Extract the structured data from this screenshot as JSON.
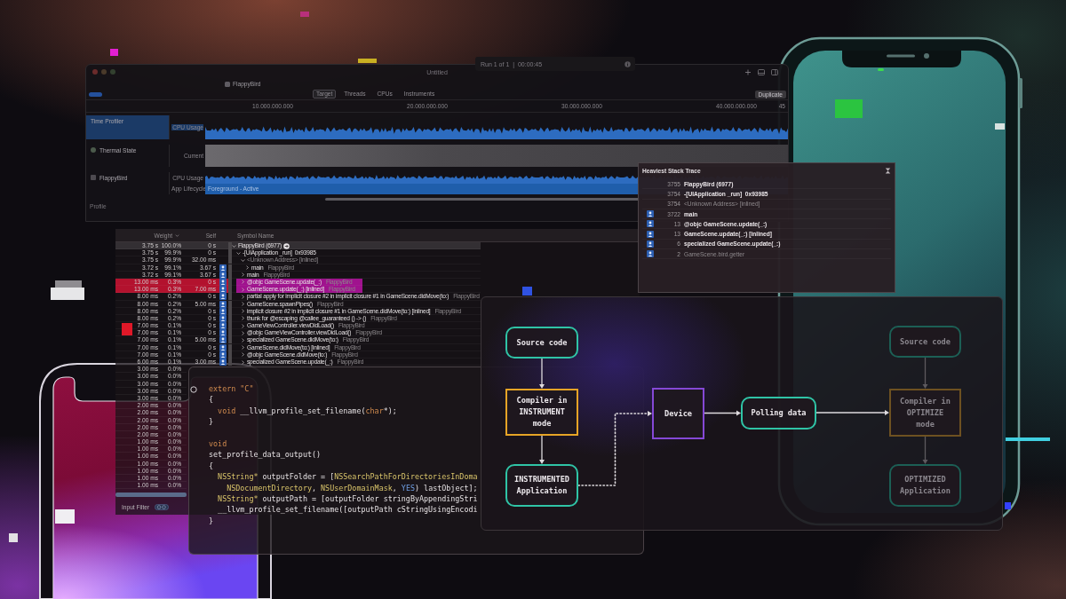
{
  "instruments_window": {
    "title": "Untitled",
    "run_status": "Run 1 of 1  |  00:00:45",
    "target_app": "FlappyBird",
    "tabs": [
      {
        "label": "Target",
        "selected": true
      },
      {
        "label": "Threads",
        "selected": false
      },
      {
        "label": "CPUs",
        "selected": false
      },
      {
        "label": "Instruments",
        "selected": false
      }
    ],
    "duplicate_button": "Duplicate",
    "ruler_labels": [
      "10.000.000.000",
      "20.000.000.000",
      "30.000.000.000",
      "40.000.000.000",
      "45"
    ],
    "tracks": [
      {
        "kind": "profiler",
        "name": "Time Profiler",
        "selected": true,
        "lanes": [
          {
            "kind": "waveform",
            "label": "CPU Usage"
          }
        ]
      },
      {
        "kind": "thermal",
        "name": "Thermal State",
        "selected": false,
        "lanes": [
          {
            "kind": "state_band",
            "label": "Current"
          }
        ]
      },
      {
        "kind": "process",
        "name": "FlappyBird",
        "selected": false,
        "lanes": [
          {
            "kind": "waveform",
            "label": "CPU Usage"
          },
          {
            "kind": "lifecycle_band",
            "label": "App Lifecycle",
            "value": "Foreground - Active"
          }
        ]
      }
    ],
    "section_label": "Profile"
  },
  "call_tree": {
    "columns": [
      "Weight",
      "Self",
      "Symbol Name"
    ],
    "rows": [
      {
        "weight": "3.75 s",
        "percent": "100.0%",
        "self": "0 s",
        "symbol": "FlappyBird (6977)",
        "selected": true,
        "expanded": true,
        "highlighted": false,
        "user_code": false,
        "dimmed": false,
        "children": [
          {
            "weight": "3.75 s",
            "percent": "99.9%",
            "self": "0 s",
            "symbol": "-[UIApplication _run]  0x93985",
            "selected": false,
            "expanded": true,
            "highlighted": false,
            "user_code": false,
            "dimmed": false,
            "children": [
              {
                "weight": "3.75 s",
                "percent": "99.9%",
                "self": "32.00 ms",
                "symbol": "<Unknown Address> [inlined]",
                "selected": false,
                "expanded": true,
                "highlighted": false,
                "user_code": false,
                "dimmed": true,
                "children": [
                  {
                    "weight": "3.72 s",
                    "percent": "99.1%",
                    "self": "3.67 s",
                    "symbol": "main",
                    "library": "FlappyBird",
                    "selected": false,
                    "expanded": false,
                    "highlighted": false,
                    "user_code": true,
                    "dimmed": false
                  }
                ]
              },
              {
                "weight": "3.72 s",
                "percent": "99.1%",
                "self": "3.67 s",
                "symbol": "main",
                "library": "FlappyBird",
                "selected": false,
                "expanded": false,
                "highlighted": false,
                "user_code": true,
                "dimmed": false
              },
              {
                "weight": "13.00 ms",
                "percent": "0.3%",
                "self": "0 s",
                "symbol": "@objc GameScene.update(_:)",
                "library": "FlappyBird",
                "selected": false,
                "expanded": false,
                "highlighted": true,
                "user_code": true,
                "dimmed": false
              },
              {
                "weight": "13.00 ms",
                "percent": "0.3%",
                "self": "7.00 ms",
                "symbol": "GameScene.update(_:) [inlined]",
                "library": "FlappyBird",
                "selected": false,
                "expanded": false,
                "highlighted": true,
                "user_code": true,
                "dimmed": false
              },
              {
                "weight": "8.00 ms",
                "percent": "0.2%",
                "self": "0 s",
                "symbol": "partial apply for implicit closure #2 in implicit closure #1 in GameScene.didMove(to:)",
                "library": "FlappyBird",
                "selected": false,
                "expanded": false,
                "highlighted": false,
                "user_code": true,
                "dimmed": false
              },
              {
                "weight": "8.00 ms",
                "percent": "0.2%",
                "self": "5.00 ms",
                "symbol": "GameScene.spawnPipes()",
                "library": "FlappyBird",
                "selected": false,
                "expanded": false,
                "highlighted": false,
                "user_code": true,
                "dimmed": false
              },
              {
                "weight": "8.00 ms",
                "percent": "0.2%",
                "self": "0 s",
                "symbol": "implicit closure #2 in implicit closure #1 in GameScene.didMove(to:) [inlined]",
                "library": "FlappyBird",
                "selected": false,
                "expanded": false,
                "highlighted": false,
                "user_code": true,
                "dimmed": false
              },
              {
                "weight": "8.00 ms",
                "percent": "0.2%",
                "self": "0 s",
                "symbol": "thunk for @escaping @callee_guaranteed () -> ()",
                "library": "FlappyBird",
                "selected": false,
                "expanded": false,
                "highlighted": false,
                "user_code": true,
                "dimmed": false
              },
              {
                "weight": "7.00 ms",
                "percent": "0.1%",
                "self": "0 s",
                "symbol": "GameViewController.viewDidLoad()",
                "library": "FlappyBird",
                "selected": false,
                "expanded": false,
                "highlighted": false,
                "user_code": true,
                "dimmed": false
              },
              {
                "weight": "7.00 ms",
                "percent": "0.1%",
                "self": "0 s",
                "symbol": "@objc GameViewController.viewDidLoad()",
                "library": "FlappyBird",
                "selected": false,
                "expanded": false,
                "highlighted": false,
                "user_code": true,
                "dimmed": false
              },
              {
                "weight": "7.00 ms",
                "percent": "0.1%",
                "self": "5.00 ms",
                "symbol": "specialized GameScene.didMove(to:)",
                "library": "FlappyBird",
                "selected": false,
                "expanded": false,
                "highlighted": false,
                "user_code": true,
                "dimmed": false
              },
              {
                "weight": "7.00 ms",
                "percent": "0.1%",
                "self": "0 s",
                "symbol": "GameScene.didMove(to:) [inlined]",
                "library": "FlappyBird",
                "selected": false,
                "expanded": false,
                "highlighted": false,
                "user_code": true,
                "dimmed": false
              },
              {
                "weight": "7.00 ms",
                "percent": "0.1%",
                "self": "0 s",
                "symbol": "@objc GameScene.didMove(to:)",
                "library": "FlappyBird",
                "selected": false,
                "expanded": false,
                "highlighted": false,
                "user_code": true,
                "dimmed": false
              },
              {
                "weight": "6.00 ms",
                "percent": "0.1%",
                "self": "3.00 ms",
                "symbol": "specialized GameScene.update(_:)",
                "library": "FlappyBird",
                "selected": false,
                "expanded": false,
                "highlighted": false,
                "user_code": true,
                "dimmed": false
              }
            ]
          }
        ]
      }
    ],
    "more_rows": [
      {
        "weight": "3.00 ms",
        "percent": "0.0%",
        "selected": false
      },
      {
        "weight": "3.00 ms",
        "percent": "0.0%",
        "selected": false
      },
      {
        "weight": "3.00 ms",
        "percent": "0.0%",
        "selected": false
      },
      {
        "weight": "3.00 ms",
        "percent": "0.0%",
        "selected": false
      },
      {
        "weight": "3.00 ms",
        "percent": "0.0%",
        "selected": false
      },
      {
        "weight": "2.00 ms",
        "percent": "0.0%",
        "selected": false
      },
      {
        "weight": "2.00 ms",
        "percent": "0.0%",
        "selected": false
      },
      {
        "weight": "2.00 ms",
        "percent": "0.0%",
        "selected": false
      },
      {
        "weight": "2.00 ms",
        "percent": "0.0%",
        "selected": false
      },
      {
        "weight": "2.00 ms",
        "percent": "0.0%",
        "selected": false
      },
      {
        "weight": "1.00 ms",
        "percent": "0.0%",
        "selected": false
      },
      {
        "weight": "1.00 ms",
        "percent": "0.0%",
        "selected": false
      },
      {
        "weight": "1.00 ms",
        "percent": "0.0%",
        "selected": false
      },
      {
        "weight": "1.00 ms",
        "percent": "0.0%",
        "selected": false
      },
      {
        "weight": "1.00 ms",
        "percent": "0.0%",
        "selected": false
      },
      {
        "weight": "1.00 ms",
        "percent": "0.0%",
        "selected": false
      },
      {
        "weight": "1.00 ms",
        "percent": "0.0%",
        "selected": false
      }
    ],
    "filter_label": "Input Filter"
  },
  "heaviest_stack_trace": {
    "title": "Heaviest Stack Trace",
    "frames": [
      {
        "count": "3755",
        "symbol": "FlappyBird (6977)",
        "user_code": false,
        "dimmed": false
      },
      {
        "count": "3754",
        "symbol": "-[UIApplication _run]  0x93985",
        "user_code": false,
        "dimmed": false
      },
      {
        "count": "3754",
        "symbol": "<Unknown Address> [inlined]",
        "user_code": false,
        "dimmed": true
      },
      {
        "count": "3722",
        "symbol": "main",
        "user_code": true,
        "dimmed": false
      },
      {
        "count": "13",
        "symbol": "@objc GameScene.update(_:)",
        "user_code": true,
        "dimmed": false
      },
      {
        "count": "13",
        "symbol": "GameScene.update(_:) [inlined]",
        "user_code": true,
        "dimmed": false
      },
      {
        "count": "6",
        "symbol": "specialized GameScene.update(_:)",
        "user_code": true,
        "dimmed": false
      },
      {
        "count": "2",
        "symbol": "GameScene.bird.getter",
        "user_code": true,
        "dimmed": true
      }
    ]
  },
  "code_editor": {
    "blocks": [
      [
        [
          {
            "kind": "keyword",
            "text": "extern \"C\""
          }
        ],
        [
          {
            "kind": "plain",
            "text": "{"
          }
        ],
        [
          {
            "kind": "keyword",
            "text": "  void"
          },
          {
            "kind": "plain",
            "text": " __llvm_profile_set_filename("
          },
          {
            "kind": "keyword",
            "text": "char"
          },
          {
            "kind": "plain",
            "text": "*);"
          }
        ],
        [
          {
            "kind": "plain",
            "text": "}"
          }
        ]
      ],
      [
        [
          {
            "kind": "keyword",
            "text": "void"
          }
        ],
        [
          {
            "kind": "plain",
            "text": "set_profile_data_output()"
          }
        ],
        [
          {
            "kind": "plain",
            "text": "{"
          }
        ],
        [
          {
            "kind": "type",
            "text": "  NSString*"
          },
          {
            "kind": "plain",
            "text": " outputFolder = ["
          },
          {
            "kind": "type",
            "text": "NSSearchPathForDirectoriesInDoma"
          }
        ],
        [
          {
            "kind": "type",
            "text": "    NSDocumentDirectory"
          },
          {
            "kind": "plain",
            "text": ", "
          },
          {
            "kind": "type",
            "text": "NSUserDomainMask"
          },
          {
            "kind": "plain",
            "text": ", "
          },
          {
            "kind": "literal",
            "text": "YES"
          },
          {
            "kind": "plain",
            "text": ") lastObject];"
          }
        ],
        [
          {
            "kind": "type",
            "text": "  NSString*"
          },
          {
            "kind": "plain",
            "text": " outputPath = [outputFolder stringByAppendingStri"
          }
        ],
        [
          {
            "kind": "plain",
            "text": "  __llvm_profile_set_filename([outputPath cStringUsingEncodi"
          }
        ],
        [
          {
            "kind": "plain",
            "text": "}"
          }
        ]
      ]
    ]
  },
  "flow_diagram": {
    "nodes": [
      {
        "label": "Source code",
        "kind": "rounded",
        "color": "#2fc4a6",
        "faded": false
      },
      {
        "label": "Compiler in INSTRUMENT mode",
        "kind": "square",
        "color": "#e6a426",
        "faded": false
      },
      {
        "label": "INSTRUMENTED Application",
        "kind": "rounded",
        "color": "#2fc4a6",
        "faded": false
      },
      {
        "label": "Device",
        "kind": "square",
        "color": "#8548d6",
        "faded": false
      },
      {
        "label": "Polling data",
        "kind": "rounded",
        "color": "#2fc4a6",
        "faded": false
      },
      {
        "label": "Source code",
        "kind": "rounded",
        "color": "#1c5f55",
        "faded": true
      },
      {
        "label": "Compiler in OPTIMIZE mode",
        "kind": "square",
        "color": "#6e5121",
        "faded": true
      },
      {
        "label": "OPTIMIZED Application",
        "kind": "rounded",
        "color": "#1c5f55",
        "faded": true
      }
    ]
  }
}
